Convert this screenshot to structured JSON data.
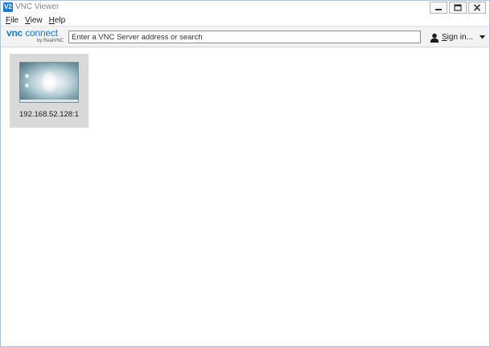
{
  "window": {
    "title": "VNC Viewer",
    "app_icon_text": "V2"
  },
  "menu": {
    "items": [
      {
        "label": "File",
        "mnemonic": "F",
        "rest": "ile"
      },
      {
        "label": "View",
        "mnemonic": "V",
        "rest": "iew"
      },
      {
        "label": "Help",
        "mnemonic": "H",
        "rest": "elp"
      }
    ]
  },
  "toolbar": {
    "logo_vnc": "vnc",
    "logo_connect": "connect",
    "logo_by": "by RealVNC",
    "search_placeholder": "Enter a VNC Server address or search",
    "search_value": "",
    "signin_mnemonic": "S",
    "signin_rest": "ign in...",
    "icons": {
      "user": "user-icon",
      "dropdown": "chevron-down-icon"
    }
  },
  "connections": [
    {
      "address": "192.168.52.128:1",
      "thumbnail": "desktop-thumbnail"
    }
  ],
  "colors": {
    "accent": "#1c7bd6",
    "tile_background": "#d9d9d9",
    "toolbar_background": "#f3f3f3"
  }
}
